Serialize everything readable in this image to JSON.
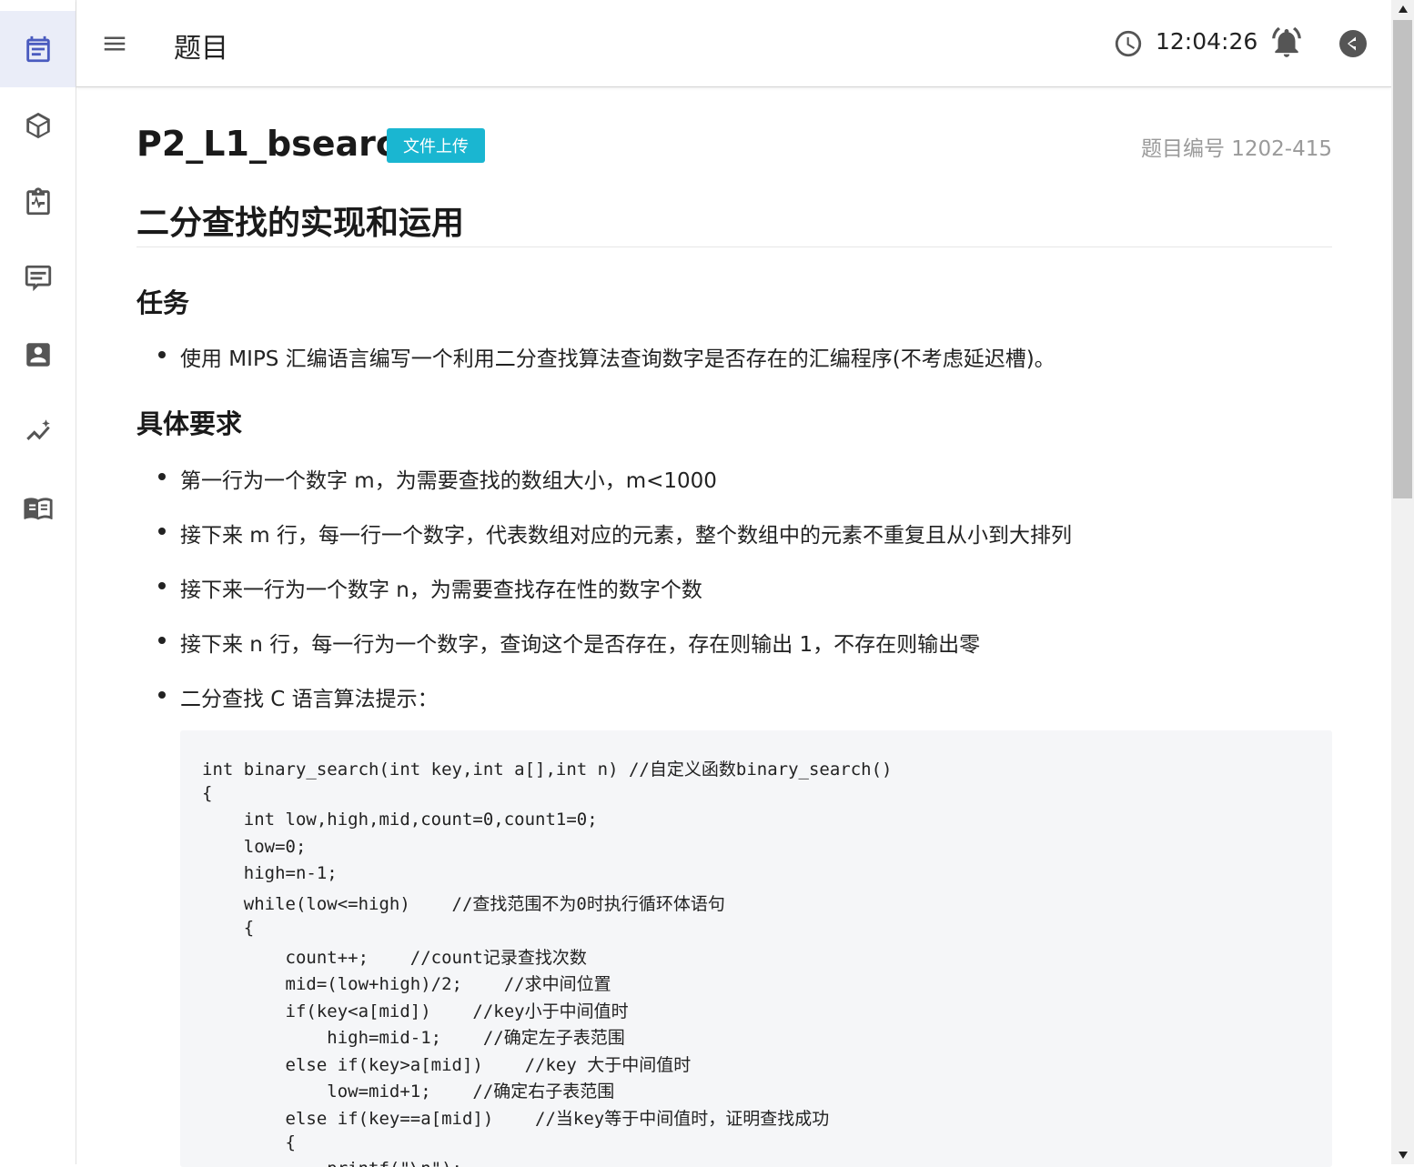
{
  "sidebar": {
    "items": [
      {
        "name": "calendar-icon",
        "active": true
      },
      {
        "name": "cube-icon",
        "active": false
      },
      {
        "name": "clipboard-pulse-icon",
        "active": false
      },
      {
        "name": "comment-icon",
        "active": false
      },
      {
        "name": "account-box-icon",
        "active": false
      },
      {
        "name": "chart-line-icon",
        "active": false
      },
      {
        "name": "book-open-icon",
        "active": false
      }
    ]
  },
  "header": {
    "title": "题目",
    "clock": "12:04:26"
  },
  "problem": {
    "id": "P2_L1_bsearch",
    "badge": "文件上传",
    "number": "题目编号 1202-415",
    "title": "二分查找的实现和运用",
    "sections": [
      {
        "heading": "任务",
        "items": [
          "使用 MIPS 汇编语言编写一个利用二分查找算法查询数字是否存在的汇编程序(不考虑延迟槽)。"
        ]
      },
      {
        "heading": "具体要求",
        "items": [
          "第一行为一个数字 m，为需要查找的数组大小，m<1000",
          "接下来 m 行，每一行一个数字，代表数组对应的元素，整个数组中的元素不重复且从小到大排列",
          "接下来一行为一个数字 n，为需要查找存在性的数字个数",
          "接下来 n 行，每一行为一个数字，查询这个是否存在，存在则输出 1，不存在则输出零",
          "二分查找 C 语言算法提示："
        ]
      }
    ],
    "code": [
      "int binary_search(int key,int a[],int n) //自定义函数binary_search()",
      "{",
      "    int low,high,mid,count=0,count1=0;",
      "    low=0;",
      "    high=n-1;",
      "    while(low<=high)    //查找范围不为0时执行循环体语句",
      "    {",
      "        count++;    //count记录查找次数",
      "        mid=(low+high)/2;    //求中间位置",
      "        if(key<a[mid])    //key小于中间值时",
      "            high=mid-1;    //确定左子表范围",
      "        else if(key>a[mid])    //key 大于中间值时",
      "            low=mid+1;    //确定右子表范围",
      "        else if(key==a[mid])    //当key等于中间值时，证明查找成功",
      "        {",
      "            printf(\"\\n\");"
    ]
  },
  "colors": {
    "accent": "#4a5bbf",
    "badge": "#1ab6d1",
    "icon": "#555555"
  }
}
